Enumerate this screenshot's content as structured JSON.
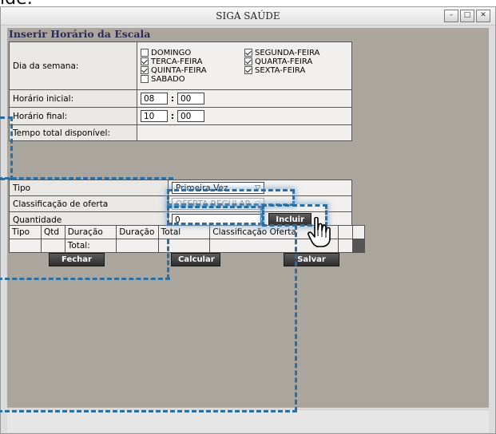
{
  "sliver_text": "ide:",
  "window": {
    "title": "SIGA SAÚDE",
    "controls": [
      "minimize-icon",
      "maximize-icon",
      "close-icon"
    ]
  },
  "form": {
    "heading": "Inserir Horário da Escala",
    "dia_label": "Dia da semana:",
    "days": [
      {
        "label": "DOMINGO",
        "checked": false
      },
      {
        "label": "SEGUNDA-FEIRA",
        "checked": true
      },
      {
        "label": "TERCA-FEIRA",
        "checked": true
      },
      {
        "label": "QUARTA-FEIRA",
        "checked": true
      },
      {
        "label": "QUINTA-FEIRA",
        "checked": true
      },
      {
        "label": "SEXTA-FEIRA",
        "checked": true
      },
      {
        "label": "SABADO",
        "checked": false
      }
    ],
    "inicio_label": "Horário inicial:",
    "inicio_h": "08",
    "inicio_m": "00",
    "fim_label": "Horário final:",
    "fim_h": "10",
    "fim_m": "00",
    "total_label": "Tempo total disponível:",
    "separator": ":"
  },
  "oferta": {
    "tipo_label": "Tipo",
    "tipo_value": "Primeira Vez",
    "classificacao_label": "Classificação de oferta",
    "classificacao_value": "OFERTA REGULAR",
    "quantidade_label": "Quantidade",
    "quantidade_value": "0",
    "incluir_label": "Incluir"
  },
  "grid": {
    "headers": [
      "Tipo",
      "Qtd",
      "Duração",
      "Duração",
      "Total",
      "Classificação Oferta"
    ],
    "total_label": "Total:"
  },
  "buttons": {
    "fechar": "Fechar",
    "calcular": "Calcular",
    "salvar": "Salvar"
  },
  "colors": {
    "content_bg": "#aaa69e",
    "highlight": "#2c6e9f"
  }
}
